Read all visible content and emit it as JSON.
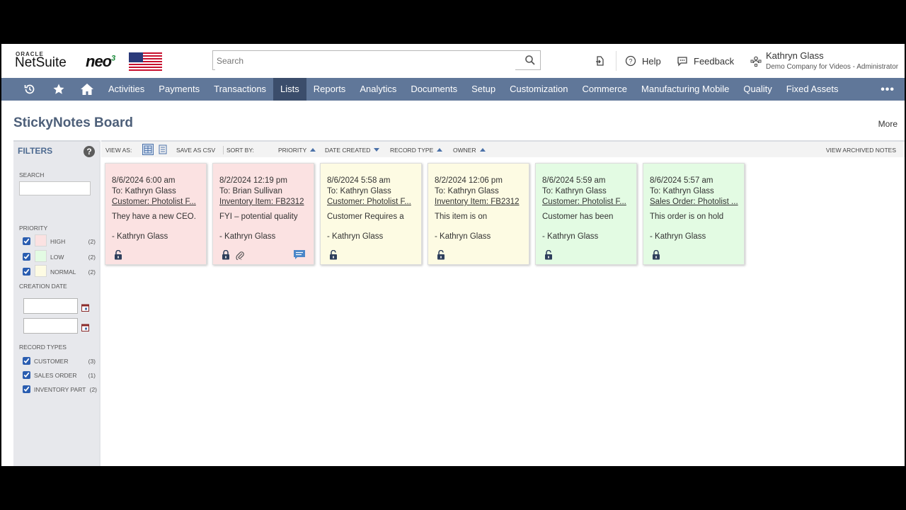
{
  "header": {
    "brand_small": "ORACLE",
    "brand": "NetSuite",
    "product": "neo",
    "product_sup": "3",
    "search_placeholder": "Search",
    "help_label": "Help",
    "feedback_label": "Feedback",
    "user_name": "Kathryn Glass",
    "user_role": "Demo Company for Videos - Administrator"
  },
  "nav": {
    "items": [
      "Activities",
      "Payments",
      "Transactions",
      "Lists",
      "Reports",
      "Analytics",
      "Documents",
      "Setup",
      "Customization",
      "Commerce",
      "Manufacturing Mobile",
      "Quality",
      "Fixed Assets"
    ],
    "active": "Lists",
    "more": "•••"
  },
  "page": {
    "title": "StickyNotes Board",
    "more": "More"
  },
  "filters": {
    "title": "FILTERS",
    "help": "?",
    "search_label": "SEARCH",
    "priority_label": "PRIORITY",
    "priorities": [
      {
        "label": "HIGH",
        "count": "(2)",
        "color": "#fbe2e2"
      },
      {
        "label": "LOW",
        "count": "(2)",
        "color": "#e3fbe3"
      },
      {
        "label": "NORMAL",
        "count": "(2)",
        "color": "#fdfbe3"
      }
    ],
    "creation_date_label": "CREATION DATE",
    "record_types_label": "RECORD TYPES",
    "record_types": [
      {
        "label": "CUSTOMER",
        "count": "(3)"
      },
      {
        "label": "SALES ORDER",
        "count": "(1)"
      },
      {
        "label": "INVENTORY PART",
        "count": "(2)"
      }
    ]
  },
  "toolbar": {
    "view_as": "VIEW AS:",
    "save_csv": "SAVE AS CSV",
    "sort_by": "SORT BY:",
    "sort_priority": "PRIORITY",
    "sort_date": "DATE CREATED",
    "sort_record": "RECORD TYPE",
    "sort_owner": "OWNER",
    "archived": "VIEW ARCHIVED NOTES"
  },
  "notes": [
    {
      "date": "8/6/2024 6:00 am",
      "to": "To: Kathryn Glass",
      "record": "Customer: Photolist F...",
      "message": "They have a new CEO.",
      "author": "- Kathryn Glass",
      "color": "#fbe2e2"
    },
    {
      "date": "8/2/2024 12:19 pm",
      "to": "To: Brian Sullivan",
      "record": "Inventory Item: FB2312",
      "message": "FYI – potential quality",
      "author": "- Kathryn Glass",
      "color": "#fbe2e2"
    },
    {
      "date": "8/6/2024 5:58 am",
      "to": "To: Kathryn Glass",
      "record": "Customer: Photolist F...",
      "message": "Customer Requires a",
      "author": "- Kathryn Glass",
      "color": "#fdfbe3"
    },
    {
      "date": "8/2/2024 12:06 pm",
      "to": "To: Kathryn Glass",
      "record": "Inventory Item: FB2312",
      "message": "This item is on",
      "author": "- Kathryn Glass",
      "color": "#fdfbe3"
    },
    {
      "date": "8/6/2024 5:59 am",
      "to": "To: Kathryn Glass",
      "record": "Customer: Photolist F...",
      "message": "Customer has been",
      "author": "- Kathryn Glass",
      "color": "#e3fbe3"
    },
    {
      "date": "8/6/2024 5:57 am",
      "to": "To: Kathryn Glass",
      "record": "Sales Order: Photolist ...",
      "message": "This order is on hold",
      "author": "- Kathryn Glass",
      "color": "#e3fbe3"
    }
  ]
}
